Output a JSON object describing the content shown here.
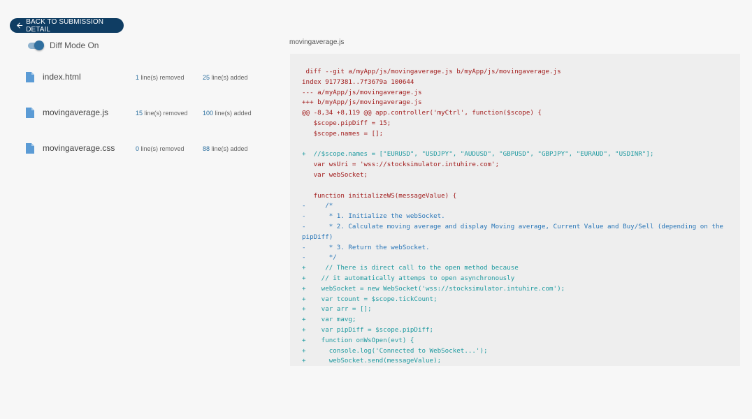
{
  "back_button": {
    "label": "BACK TO SUBMISSION DETAIL",
    "icon": "arrow-left-icon"
  },
  "diff_mode": {
    "label": "Diff Mode On",
    "enabled": true
  },
  "files": [
    {
      "name": "index.html",
      "removed_count": "1",
      "removed_label": "line(s) removed",
      "added_count": "25",
      "added_label": "line(s) added"
    },
    {
      "name": "movingaverage.js",
      "removed_count": "15",
      "removed_label": "line(s) removed",
      "added_count": "100",
      "added_label": "line(s) added"
    },
    {
      "name": "movingaverage.css",
      "removed_count": "0",
      "removed_label": "line(s) removed",
      "added_count": "88",
      "added_label": "line(s) added"
    }
  ],
  "colors": {
    "button_bg": "#0f3d63",
    "accent": "#2b6f9f",
    "diff_header": "#a21d1d",
    "diff_added": "#1f9aa0",
    "diff_removed": "#2a77b8"
  },
  "diff": {
    "file_name": "movingaverage.js",
    "lines": [
      {
        "type": "header",
        "text": " diff --git a/myApp/js/movingaverage.js b/myApp/js/movingaverage.js"
      },
      {
        "type": "meta",
        "text": "index 9177381..7f3679a 100644"
      },
      {
        "type": "meta",
        "text": "--- a/myApp/js/movingaverage.js"
      },
      {
        "type": "meta",
        "text": "+++ b/myApp/js/movingaverage.js"
      },
      {
        "type": "meta",
        "text": "@@ -8,34 +8,119 @@ app.controller('myCtrl', function($scope) {"
      },
      {
        "type": "context",
        "text": "   $scope.pipDiff = 15;"
      },
      {
        "type": "context",
        "text": "   $scope.names = [];"
      },
      {
        "type": "blank",
        "text": ""
      },
      {
        "type": "add",
        "text": "+  //$scope.names = [\"EURUSD\", \"USDJPY\", \"AUDUSD\", \"GBPUSD\", \"GBPJPY\", \"EURAUD\", \"USDINR\"];"
      },
      {
        "type": "context",
        "text": "   var wsUri = 'wss://stocksimulator.intuhire.com';"
      },
      {
        "type": "context",
        "text": "   var webSocket;"
      },
      {
        "type": "blank",
        "text": ""
      },
      {
        "type": "context",
        "text": "   function initializeWS(messageValue) {"
      },
      {
        "type": "rem",
        "text": "-     /*"
      },
      {
        "type": "rem",
        "text": "-      * 1. Initialize the webSocket."
      },
      {
        "type": "rem",
        "text": "-      * 2. Calculate moving average and display Moving average, Current Value and Buy/Sell (depending on the pipDiff)"
      },
      {
        "type": "rem",
        "text": "-      * 3. Return the webSocket."
      },
      {
        "type": "rem",
        "text": "-      */"
      },
      {
        "type": "add",
        "text": "+     // There is direct call to the open method because"
      },
      {
        "type": "add",
        "text": "+    // it automatically attemps to open asynchronously"
      },
      {
        "type": "add",
        "text": "+    webSocket = new WebSocket('wss://stocksimulator.intuhire.com');"
      },
      {
        "type": "add",
        "text": "+    var tcount = $scope.tickCount;"
      },
      {
        "type": "add",
        "text": "+    var arr = [];"
      },
      {
        "type": "add",
        "text": "+    var mavg;"
      },
      {
        "type": "add",
        "text": "+    var pipDiff = $scope.pipDiff;"
      },
      {
        "type": "add",
        "text": "+    function onWsOpen(evt) {"
      },
      {
        "type": "add",
        "text": "+      console.log('Connected to WebSocket...');"
      },
      {
        "type": "add",
        "text": "+      webSocket.send(messageValue);"
      }
    ]
  }
}
